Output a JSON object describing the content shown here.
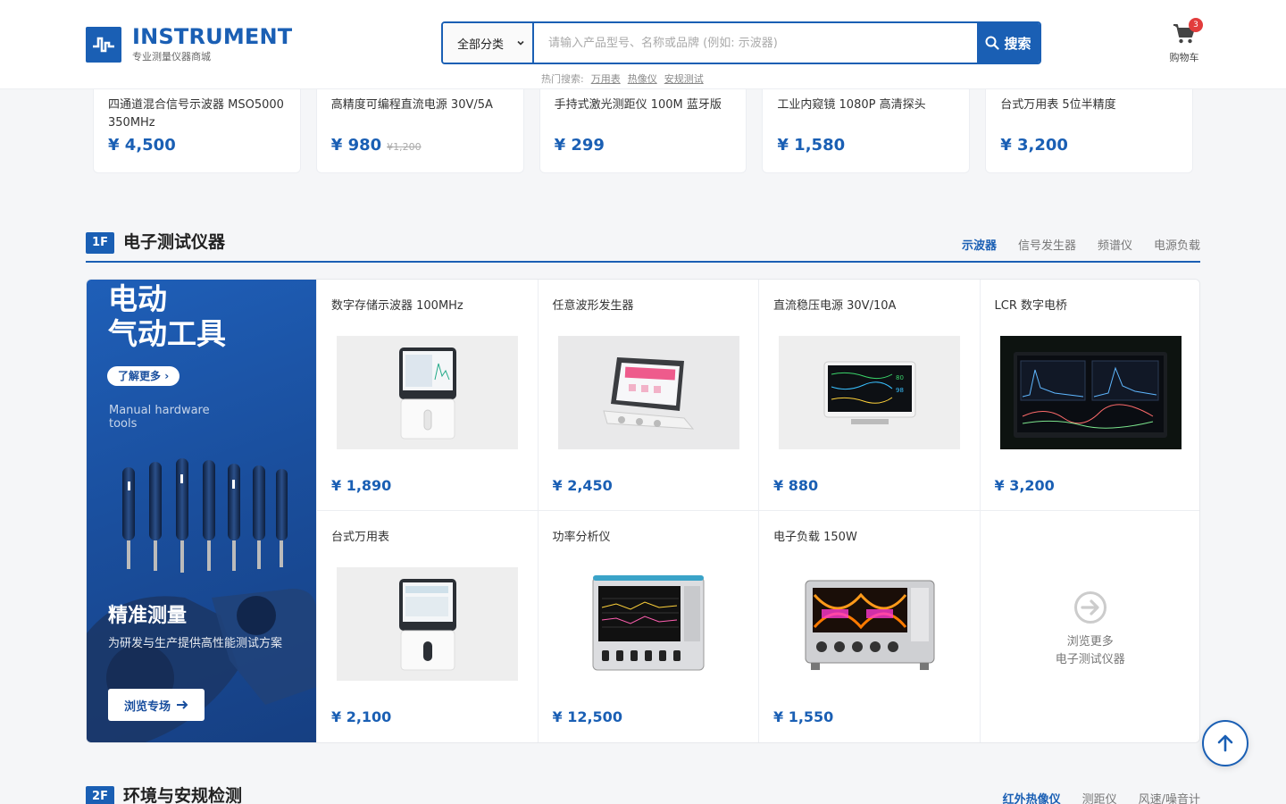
{
  "header": {
    "logo_name": "INSTRUMENT",
    "logo_sub": "专业测量仪器商城",
    "search_category": "全部分类",
    "search_placeholder": "请输入产品型号、名称或品牌 (例如: 示波器)",
    "search_button": "搜索",
    "hot_label": "热门搜索:",
    "hot_terms": [
      "万用表",
      "热像仪",
      "安规测试"
    ],
    "cart_count": "3",
    "cart_label": "购物车"
  },
  "strip": [
    {
      "name": "四通道混合信号示波器 MSO5000 350MHz",
      "price": "¥ 4,500",
      "old_price": ""
    },
    {
      "name": "高精度可编程直流电源 30V/5A",
      "price": "¥ 980",
      "old_price": "¥1,200"
    },
    {
      "name": "手持式激光测距仪 100M 蓝牙版",
      "price": "¥ 299",
      "old_price": ""
    },
    {
      "name": "工业内窥镜 1080P 高清探头",
      "price": "¥ 1,580",
      "old_price": ""
    },
    {
      "name": "台式万用表 5位半精度",
      "price": "¥ 3,200",
      "old_price": ""
    }
  ],
  "floor1": {
    "badge": "1F",
    "title": "电子测试仪器",
    "tabs": [
      "示波器",
      "信号发生器",
      "频谱仪",
      "电源负载"
    ],
    "banner": {
      "title_line1": "电动",
      "title_line2": "气动工具",
      "more": "了解更多",
      "en_line1": "Manual hardware",
      "en_line2": "tools",
      "sub": "精准测量",
      "desc": "为研发与生产提供高性能测试方案",
      "button": "浏览专场"
    },
    "products": [
      {
        "name": "数字存储示波器 100MHz",
        "price": "¥ 1,890"
      },
      {
        "name": "任意波形发生器",
        "price": "¥ 2,450"
      },
      {
        "name": "直流稳压电源 30V/10A",
        "price": "¥ 880"
      },
      {
        "name": "LCR 数字电桥",
        "price": "¥ 3,200"
      },
      {
        "name": "台式万用表",
        "price": "¥ 2,100"
      },
      {
        "name": "功率分析仪",
        "price": "¥ 12,500"
      },
      {
        "name": "电子负载 150W",
        "price": "¥ 1,550"
      }
    ],
    "more_line1": "浏览更多",
    "more_line2": "电子测试仪器"
  },
  "floor2": {
    "badge": "2F",
    "title": "环境与安规检测",
    "tabs": [
      "红外热像仪",
      "测距仪",
      "风速/噪音计"
    ]
  },
  "colors": {
    "brand": "#1a5fb4",
    "badge": "#e23c3c"
  }
}
